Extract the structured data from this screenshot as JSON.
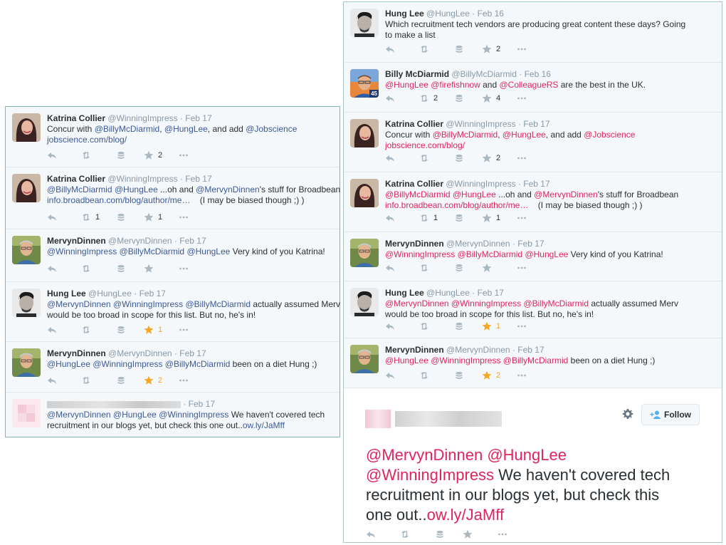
{
  "left": {
    "tweets": [
      {
        "name": "Katrina Collier",
        "handle": "@WinningImpress",
        "date": "Feb 17",
        "lines": [
          [
            [
              "Concur with ",
              0
            ],
            [
              "@BillyMcDiarmid",
              1
            ],
            [
              ", ",
              0
            ],
            [
              "@HungLee",
              1
            ],
            [
              ", and add ",
              0
            ],
            [
              "@Jobscience",
              1
            ]
          ],
          [
            [
              "jobscience.com/blog/",
              1
            ]
          ]
        ],
        "counts": {
          "retweet": "",
          "star": "2"
        }
      },
      {
        "name": "Katrina Collier",
        "handle": "@WinningImpress",
        "date": "Feb 17",
        "lines": [
          [
            [
              "@BillyMcDiarmid",
              1
            ],
            [
              " ",
              0
            ],
            [
              "@HungLee",
              1
            ],
            [
              " ...oh and ",
              0
            ],
            [
              "@MervynDinnen",
              1
            ],
            [
              "'s stuff for Broadbean",
              0
            ]
          ],
          [
            [
              "info.broadbean.com/blog/author/me…",
              1
            ],
            [
              "    (I may be biased though ;) )",
              0
            ]
          ]
        ],
        "counts": {
          "retweet": "1",
          "star": "1"
        }
      },
      {
        "name": "MervynDinnen",
        "handle": "@MervynDinnen",
        "date": "Feb 17",
        "lines": [
          [
            [
              "@WinningImpress",
              1
            ],
            [
              " ",
              0
            ],
            [
              "@BillyMcDiarmid",
              1
            ],
            [
              " ",
              0
            ],
            [
              "@HungLee",
              1
            ],
            [
              " Very kind of you Katrina!",
              0
            ]
          ]
        ],
        "counts": {
          "retweet": "",
          "star": ""
        }
      },
      {
        "name": "Hung Lee",
        "handle": "@HungLee",
        "date": "Feb 17",
        "lines": [
          [
            [
              "@MervynDinnen",
              1
            ],
            [
              " ",
              0
            ],
            [
              "@WinningImpress",
              1
            ],
            [
              " ",
              0
            ],
            [
              "@BillyMcDiarmid",
              1
            ],
            [
              " actually assumed Merv",
              0
            ]
          ],
          [
            [
              "would be too broad in scope for this list. But no, he's in!",
              0
            ]
          ]
        ],
        "counts": {
          "retweet": "",
          "star": "1"
        },
        "starred": true
      },
      {
        "name": "MervynDinnen",
        "handle": "@MervynDinnen",
        "date": "Feb 17",
        "lines": [
          [
            [
              "@HungLee",
              1
            ],
            [
              " ",
              0
            ],
            [
              "@WinningImpress",
              1
            ],
            [
              " ",
              0
            ],
            [
              "@BillyMcDiarmid",
              1
            ],
            [
              " been on a diet Hung ;)",
              0
            ]
          ]
        ],
        "counts": {
          "retweet": "",
          "star": "2"
        },
        "starred": true
      },
      {
        "name": "",
        "handle": "",
        "date": "Feb 17",
        "lines": [
          [
            [
              "@MervynDinnen",
              1
            ],
            [
              " ",
              0
            ],
            [
              "@HungLee",
              1
            ],
            [
              " ",
              0
            ],
            [
              "@WinningImpress",
              1
            ],
            [
              " We haven't covered tech",
              0
            ]
          ],
          [
            [
              "recruitment in our blogs yet, but check this one out..",
              0
            ],
            [
              "ow.ly/JaMff",
              1
            ]
          ]
        ],
        "counts": null
      }
    ]
  },
  "right": {
    "tweets": [
      {
        "name": "Hung Lee",
        "handle": "@HungLee",
        "date": "Feb 16",
        "lines": [
          [
            [
              "Which recruitment tech vendors are producing great content these days? Going",
              0
            ]
          ],
          [
            [
              "to make a list",
              0
            ]
          ]
        ],
        "counts": {
          "retweet": "",
          "star": "2"
        }
      },
      {
        "name": "Billy McDiarmid",
        "handle": "@BillyMcDiarmid",
        "date": "Feb 16",
        "badge": "45",
        "lines": [
          [
            [
              "@HungLee",
              1
            ],
            [
              " ",
              0
            ],
            [
              "@firefishnow",
              1
            ],
            [
              " and ",
              0
            ],
            [
              "@ColleagueRS",
              1
            ],
            [
              " are the best in the UK.",
              0
            ]
          ]
        ],
        "counts": {
          "retweet": "2",
          "star": "4"
        }
      },
      {
        "name": "Katrina Collier",
        "handle": "@WinningImpress",
        "date": "Feb 17",
        "lines": [
          [
            [
              "Concur with ",
              0
            ],
            [
              "@BillyMcDiarmid",
              1
            ],
            [
              ", ",
              0
            ],
            [
              "@HungLee",
              1
            ],
            [
              ", and add ",
              0
            ],
            [
              "@Jobscience",
              1
            ]
          ],
          [
            [
              "jobscience.com/blog/",
              1
            ]
          ]
        ],
        "counts": {
          "retweet": "",
          "star": "2"
        }
      },
      {
        "name": "Katrina Collier",
        "handle": "@WinningImpress",
        "date": "Feb 17",
        "lines": [
          [
            [
              "@BillyMcDiarmid",
              1
            ],
            [
              " ",
              0
            ],
            [
              "@HungLee",
              1
            ],
            [
              " ...oh and ",
              0
            ],
            [
              "@MervynDinnen",
              1
            ],
            [
              "'s stuff for Broadbean",
              0
            ]
          ],
          [
            [
              "info.broadbean.com/blog/author/me…",
              1
            ],
            [
              "    (I may be biased though ;) )",
              0
            ]
          ]
        ],
        "counts": {
          "retweet": "1",
          "star": "1"
        }
      },
      {
        "name": "MervynDinnen",
        "handle": "@MervynDinnen",
        "date": "Feb 17",
        "lines": [
          [
            [
              "@WinningImpress",
              1
            ],
            [
              " ",
              0
            ],
            [
              "@BillyMcDiarmid",
              1
            ],
            [
              " ",
              0
            ],
            [
              "@HungLee",
              1
            ],
            [
              " Very kind of you Katrina!",
              0
            ]
          ]
        ],
        "counts": {
          "retweet": "",
          "star": ""
        }
      },
      {
        "name": "Hung Lee",
        "handle": "@HungLee",
        "date": "Feb 17",
        "lines": [
          [
            [
              "@MervynDinnen",
              1
            ],
            [
              " ",
              0
            ],
            [
              "@WinningImpress",
              1
            ],
            [
              " ",
              0
            ],
            [
              "@BillyMcDiarmid",
              1
            ],
            [
              " actually assumed Merv",
              0
            ]
          ],
          [
            [
              "would be too broad in scope for this list. But no, he's in!",
              0
            ]
          ]
        ],
        "counts": {
          "retweet": "",
          "star": "1"
        },
        "starred": true
      },
      {
        "name": "MervynDinnen",
        "handle": "@MervynDinnen",
        "date": "Feb 17",
        "lines": [
          [
            [
              "@HungLee",
              1
            ],
            [
              " ",
              0
            ],
            [
              "@WinningImpress",
              1
            ],
            [
              " ",
              0
            ],
            [
              "@BillyMcDiarmid",
              1
            ],
            [
              " been on a diet Hung ;)",
              0
            ]
          ]
        ],
        "counts": {
          "retweet": "",
          "star": "2"
        },
        "starred": true
      }
    ],
    "main_tweet": {
      "follow_label": "Follow",
      "lines": [
        [
          [
            "@MervynDinnen",
            1
          ],
          [
            " ",
            0
          ],
          [
            "@HungLee",
            1
          ]
        ],
        [
          [
            "@WinningImpress",
            1
          ],
          [
            " We haven't covered tech",
            0
          ]
        ],
        [
          [
            "recruitment in our blogs yet, but check this",
            0
          ]
        ],
        [
          [
            "one out..",
            0
          ],
          [
            "ow.ly/JaMff",
            1
          ]
        ]
      ]
    }
  },
  "colors": {
    "mention_left": "#3b5998",
    "mention_right": "#e0245e",
    "star_active": "#f5a623",
    "icon": "#aab8c2"
  },
  "icons": [
    "reply-icon",
    "retweet-icon",
    "stack-icon",
    "star-icon",
    "more-icon",
    "gear-icon",
    "follow-person-icon"
  ]
}
